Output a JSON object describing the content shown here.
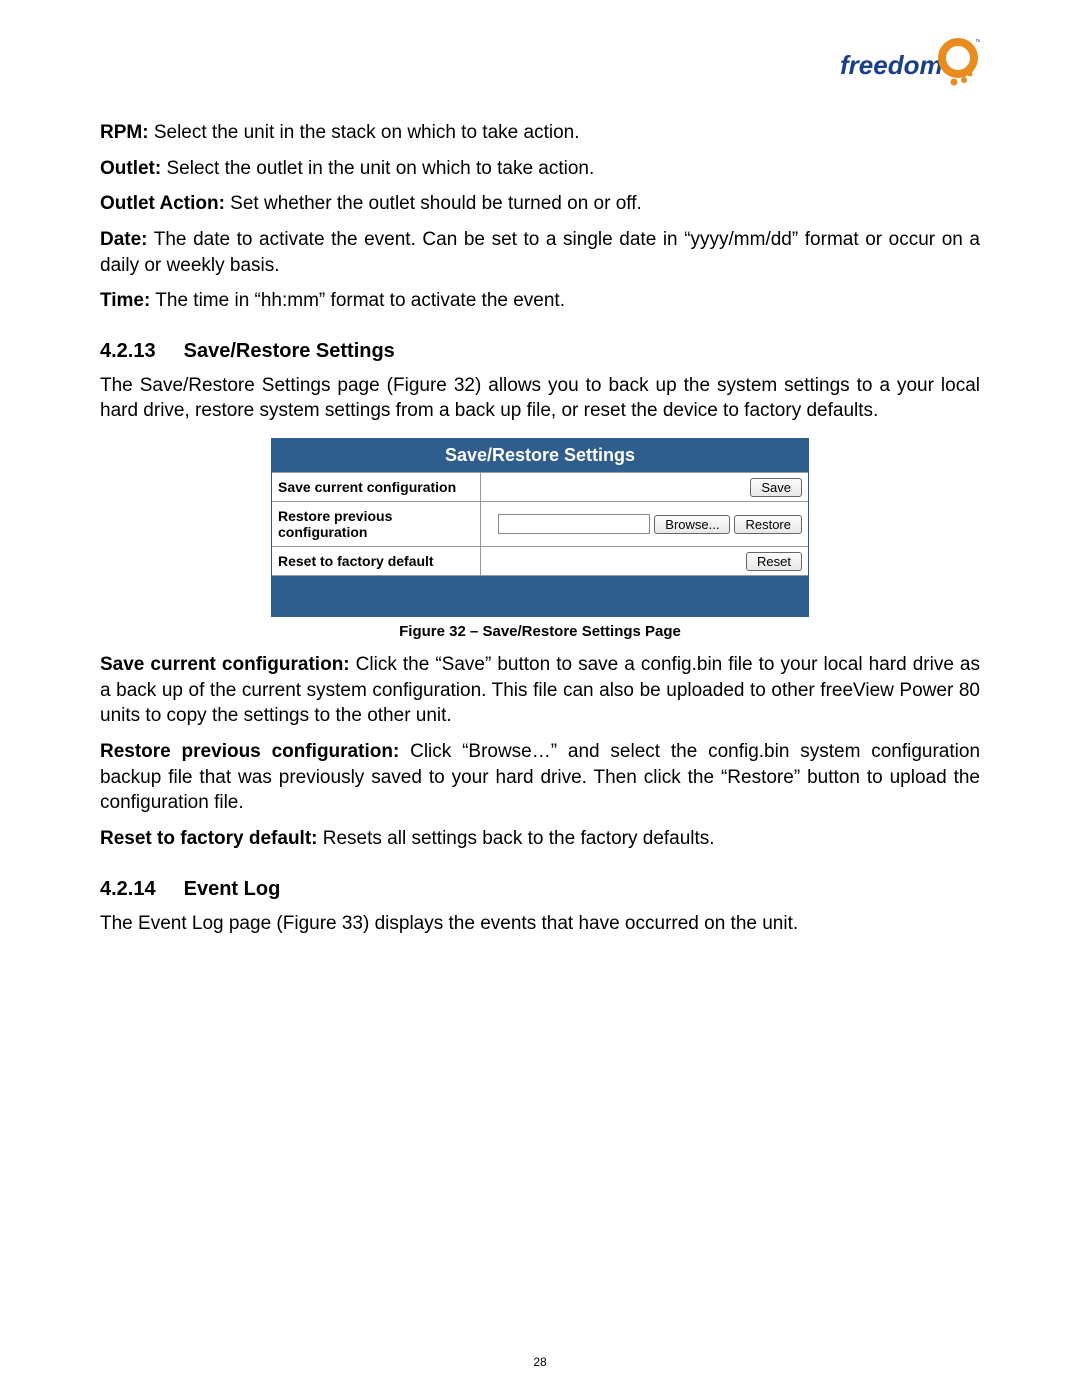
{
  "logo": {
    "brand_text": "freedom",
    "brand_color_blue": "#1a3f8a",
    "brand_color_orange": "#e98b1f"
  },
  "definitions": [
    {
      "label": "RPM:",
      "text": " Select the unit in the stack on which to take action."
    },
    {
      "label": "Outlet:",
      "text": " Select the outlet in the unit on which to take action."
    },
    {
      "label": "Outlet Action:",
      "text": " Set whether the outlet should be turned on or off."
    },
    {
      "label": "Date:",
      "text": " The date to activate the event. Can be set to a single date in “yyyy/mm/dd” format or occur on a daily or weekly basis."
    },
    {
      "label": "Time:",
      "text": " The time in “hh:mm” format to activate the event."
    }
  ],
  "section1": {
    "num": "4.2.13",
    "title": "Save/Restore Settings",
    "intro": "The Save/Restore Settings page (Figure 32) allows you to back up the system settings to a your local hard drive, restore system settings from a back up file, or reset the device to factory defaults."
  },
  "figure": {
    "header": "Save/Restore Settings",
    "rows": {
      "save": {
        "label": "Save current configuration",
        "button": "Save"
      },
      "restore": {
        "label": "Restore previous configuration",
        "browse": "Browse...",
        "button": "Restore"
      },
      "reset": {
        "label": "Reset to factory default",
        "button": "Reset"
      }
    },
    "caption": "Figure 32 – Save/Restore Settings Page"
  },
  "post_figure": [
    {
      "label": "Save current configuration:",
      "text": " Click the “Save” button to save a config.bin file to your local hard drive as a back up of the current system configuration. This file can also be uploaded to other freeView Power 80 units to copy the settings to the other unit."
    },
    {
      "label": "Restore previous configuration:",
      "text": " Click “Browse…” and select the config.bin system configuration backup file that was previously saved to your hard drive. Then click the “Restore” button to upload the configuration file."
    },
    {
      "label": "Reset to factory default:",
      "text": " Resets all settings back to the factory defaults."
    }
  ],
  "section2": {
    "num": "4.2.14",
    "title": "Event Log",
    "intro": "The Event Log page (Figure 33) displays the events that have occurred on the unit."
  },
  "page_number": "28"
}
